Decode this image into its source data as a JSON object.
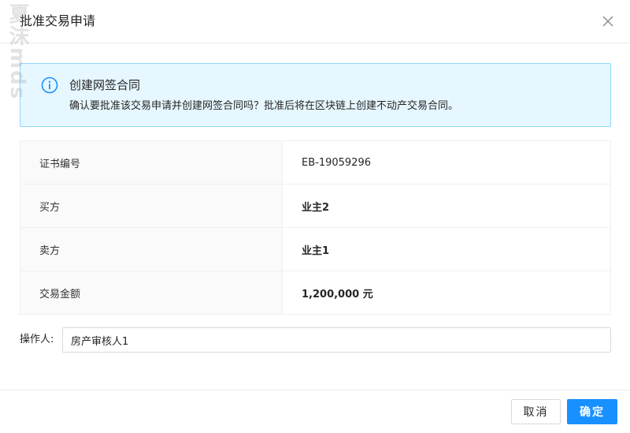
{
  "dialog": {
    "title": "批准交易申请",
    "close_icon": "close-icon"
  },
  "alert": {
    "icon": "info-icon",
    "title": "创建网签合同",
    "description": "确认要批准该交易申请并创建网签合同吗？批准后将在区块链上创建不动产交易合同。",
    "colors": {
      "background": "#e6f7ff",
      "border": "#91d5ff",
      "icon": "#1890ff"
    }
  },
  "details": {
    "rows": [
      {
        "label": "证书编号",
        "value": "EB-19059296",
        "bold": false
      },
      {
        "label": "买方",
        "value": "业主2",
        "bold": true
      },
      {
        "label": "卖方",
        "value": "业主1",
        "bold": true
      },
      {
        "label": "交易金额",
        "value": "1,200,000 元",
        "bold": true
      }
    ]
  },
  "operator": {
    "label": "操作人:",
    "value": "房产审核人1"
  },
  "footer": {
    "cancel_label": "取消",
    "ok_label": "确定",
    "primary_color": "#1890ff"
  },
  "watermark": {
    "text": "夏沫mds"
  }
}
